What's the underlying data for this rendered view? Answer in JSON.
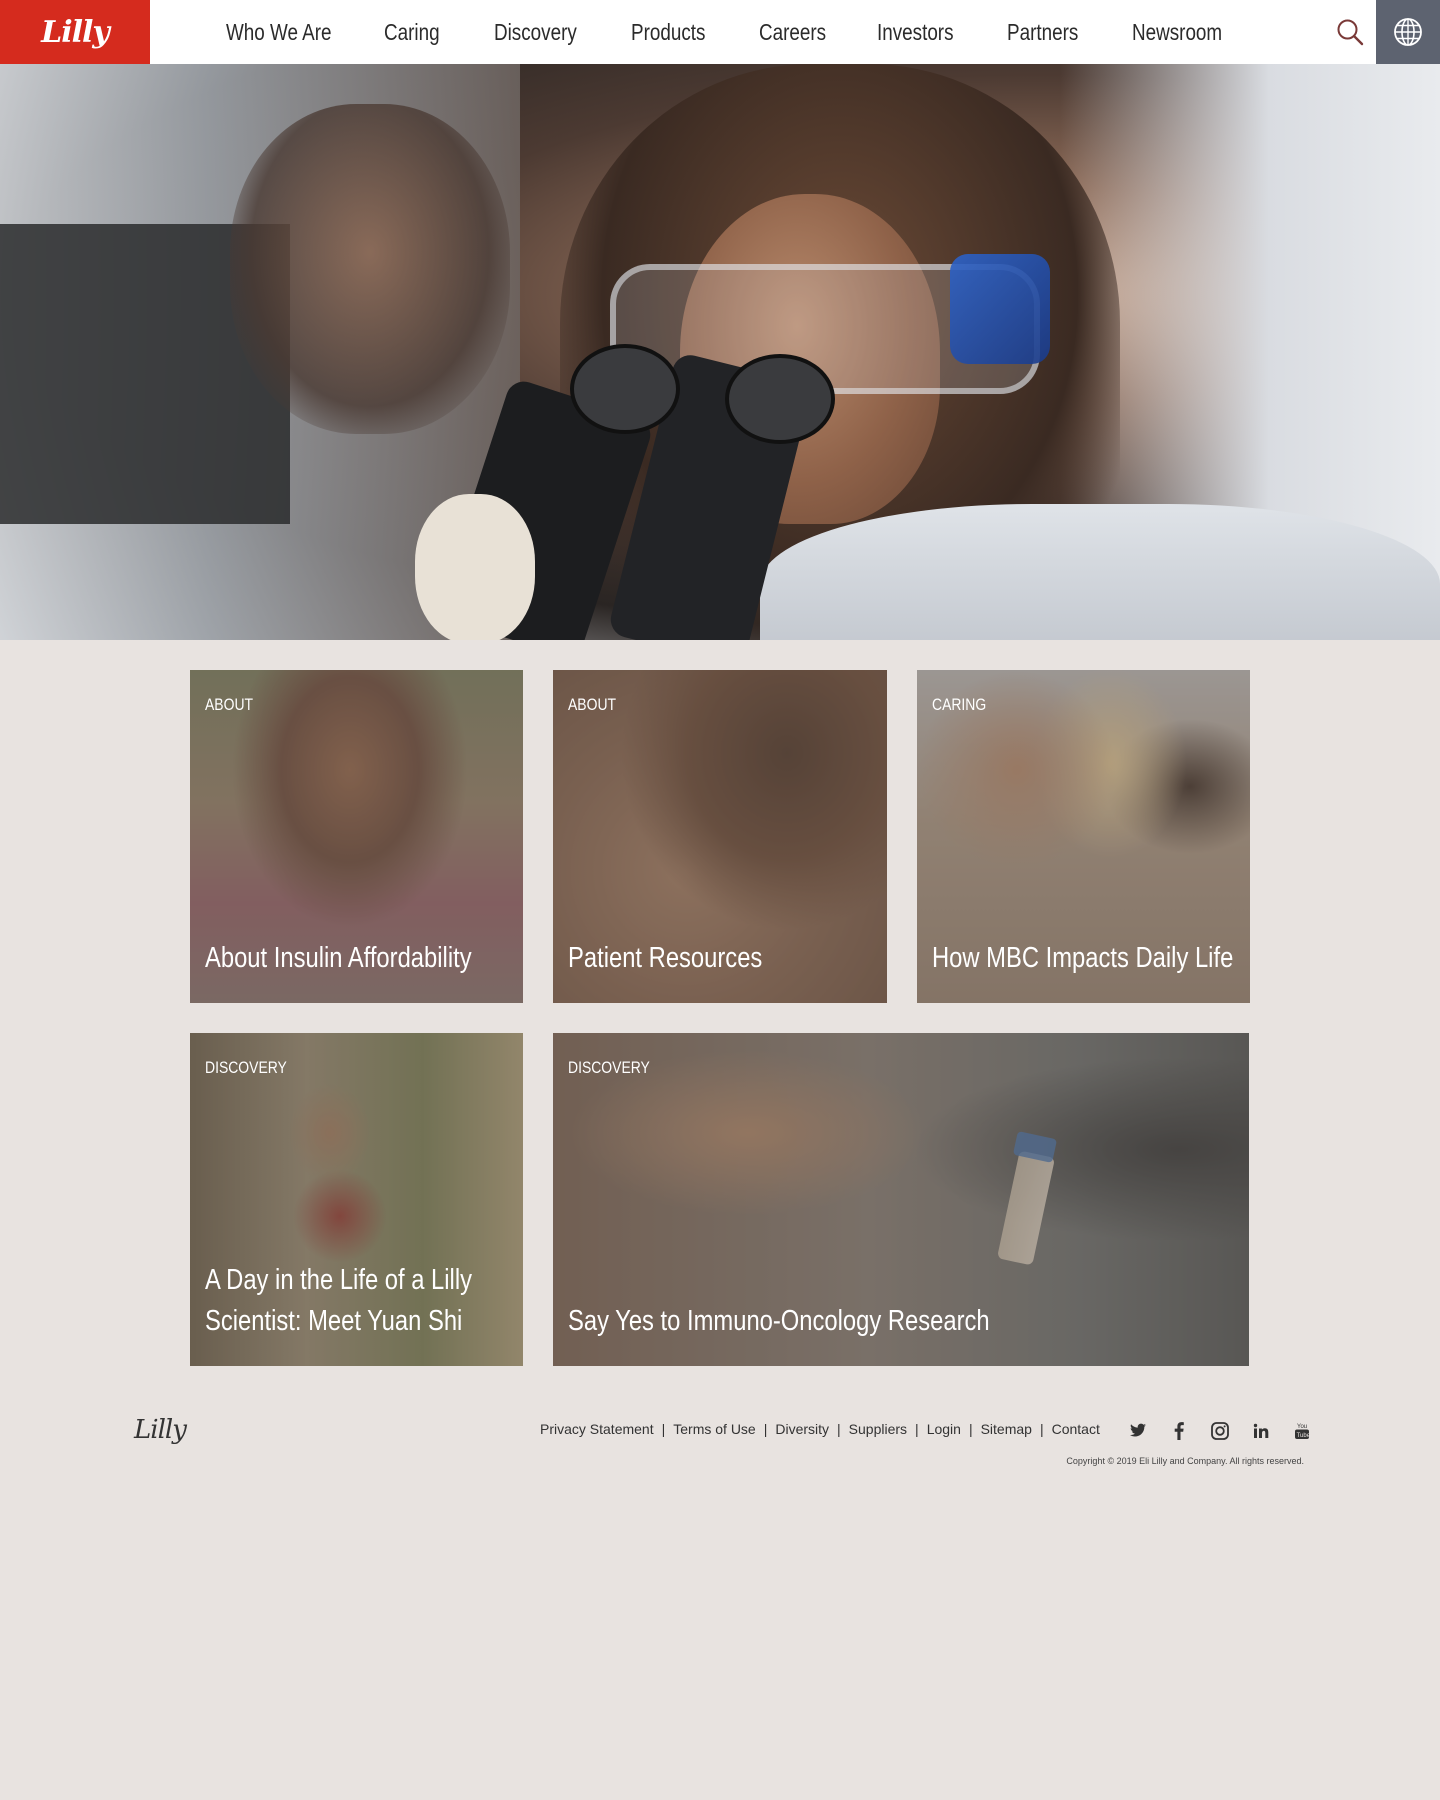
{
  "header": {
    "logo": "Lilly",
    "nav": [
      "Who We Are",
      "Caring",
      "Discovery",
      "Products",
      "Careers",
      "Investors",
      "Partners",
      "Newsroom"
    ],
    "search_icon": "search-icon",
    "globe_icon": "globe-icon",
    "brand_color": "#d52b1e"
  },
  "cards": [
    {
      "category": "About",
      "title": "About Insulin Affordability"
    },
    {
      "category": "About",
      "title": "Patient Resources"
    },
    {
      "category": "Caring",
      "title": "How MBC Impacts Daily Life"
    },
    {
      "category": "Discovery",
      "title": "A Day in the Life of a Lilly Scientist: Meet Yuan Shi"
    },
    {
      "category": "Discovery",
      "title": "Say Yes to Immuno-Oncology Research"
    }
  ],
  "footer": {
    "logo": "Lilly",
    "links": [
      "Privacy Statement",
      "Terms of Use",
      "Diversity",
      "Suppliers",
      "Login",
      "Sitemap",
      "Contact"
    ],
    "separator": "|",
    "social": [
      "twitter-icon",
      "facebook-icon",
      "instagram-icon",
      "linkedin-icon",
      "youtube-icon"
    ],
    "copyright": "Copyright © 2019 Eli Lilly and Company. All rights reserved."
  }
}
